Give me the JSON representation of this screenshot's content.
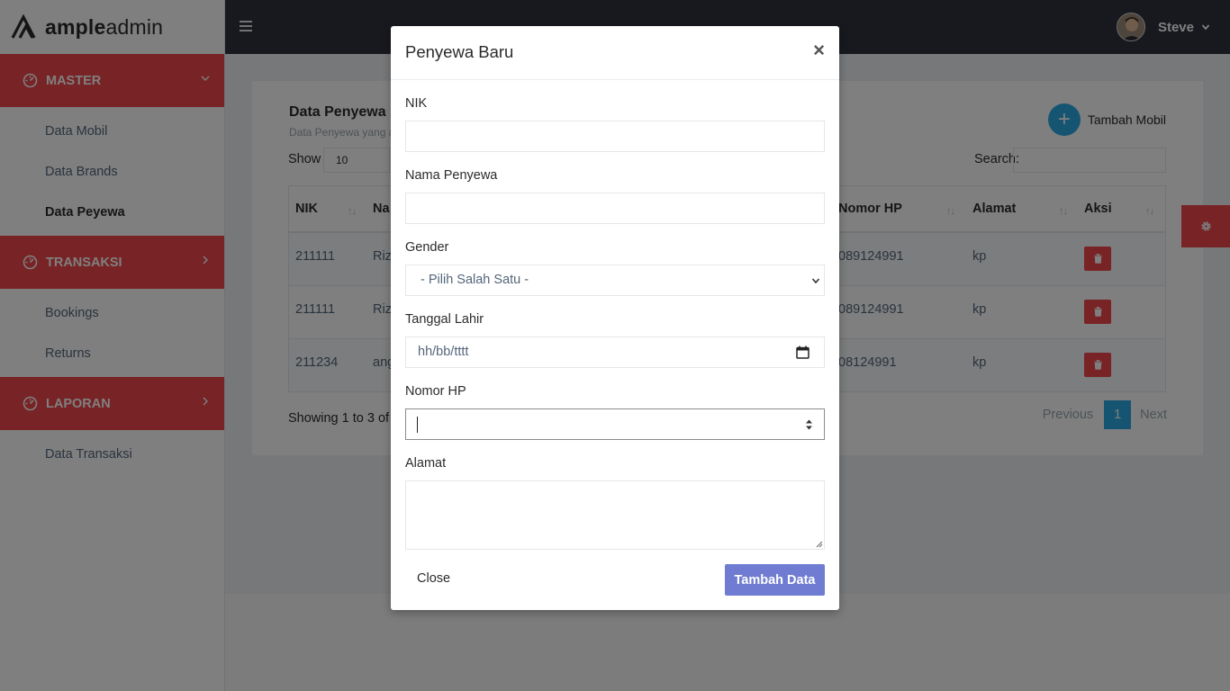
{
  "brand": {
    "bold": "ample",
    "light": "admin"
  },
  "topbar": {
    "user_name": "Steve"
  },
  "sidebar": {
    "sections": [
      {
        "label": "MASTER",
        "items": [
          "Data Mobil",
          "Data Brands",
          "Data Peyewa"
        ],
        "active": "Data Peyewa"
      },
      {
        "label": "TRANSAKSI",
        "items": [
          "Bookings",
          "Returns"
        ]
      },
      {
        "label": "LAPORAN",
        "items": [
          "Data Transaksi"
        ]
      }
    ]
  },
  "card": {
    "title": "Data Penyewa",
    "subtitle": "Data Penyewa yang a",
    "add_button": "Tambah Mobil",
    "show_label": "Show",
    "show_value": "10",
    "search_label": "Search:",
    "columns": [
      "NIK",
      "Na",
      "Nomor HP",
      "Alamat",
      "Aksi"
    ],
    "rows": [
      {
        "nik": "211111",
        "nama": "Riz",
        "hp": "089124991",
        "alamat": "kp"
      },
      {
        "nik": "211111",
        "nama": "Riz",
        "hp": "089124991",
        "alamat": "kp"
      },
      {
        "nik": "211234",
        "nama": "ang",
        "hp": "08124991",
        "alamat": "kp"
      }
    ],
    "showing_text": "Showing 1 to 3 of",
    "pager": {
      "previous": "Previous",
      "page": "1",
      "next": "Next"
    }
  },
  "modal": {
    "title": "Penyewa Baru",
    "fields": {
      "nik_label": "NIK",
      "nama_label": "Nama Penyewa",
      "gender_label": "Gender",
      "gender_value": "- Pilih Salah Satu -",
      "tanggal_label": "Tanggal Lahir",
      "tanggal_placeholder": "hh/bb/tttt",
      "hp_label": "Nomor HP",
      "alamat_label": "Alamat"
    },
    "close_label": "Close",
    "submit_label": "Tambah Data"
  },
  "colors": {
    "accent_red": "#f0474b",
    "accent_blue": "#2cabe3",
    "primary_purple": "#707cd2",
    "topbar": "#2f323e"
  }
}
